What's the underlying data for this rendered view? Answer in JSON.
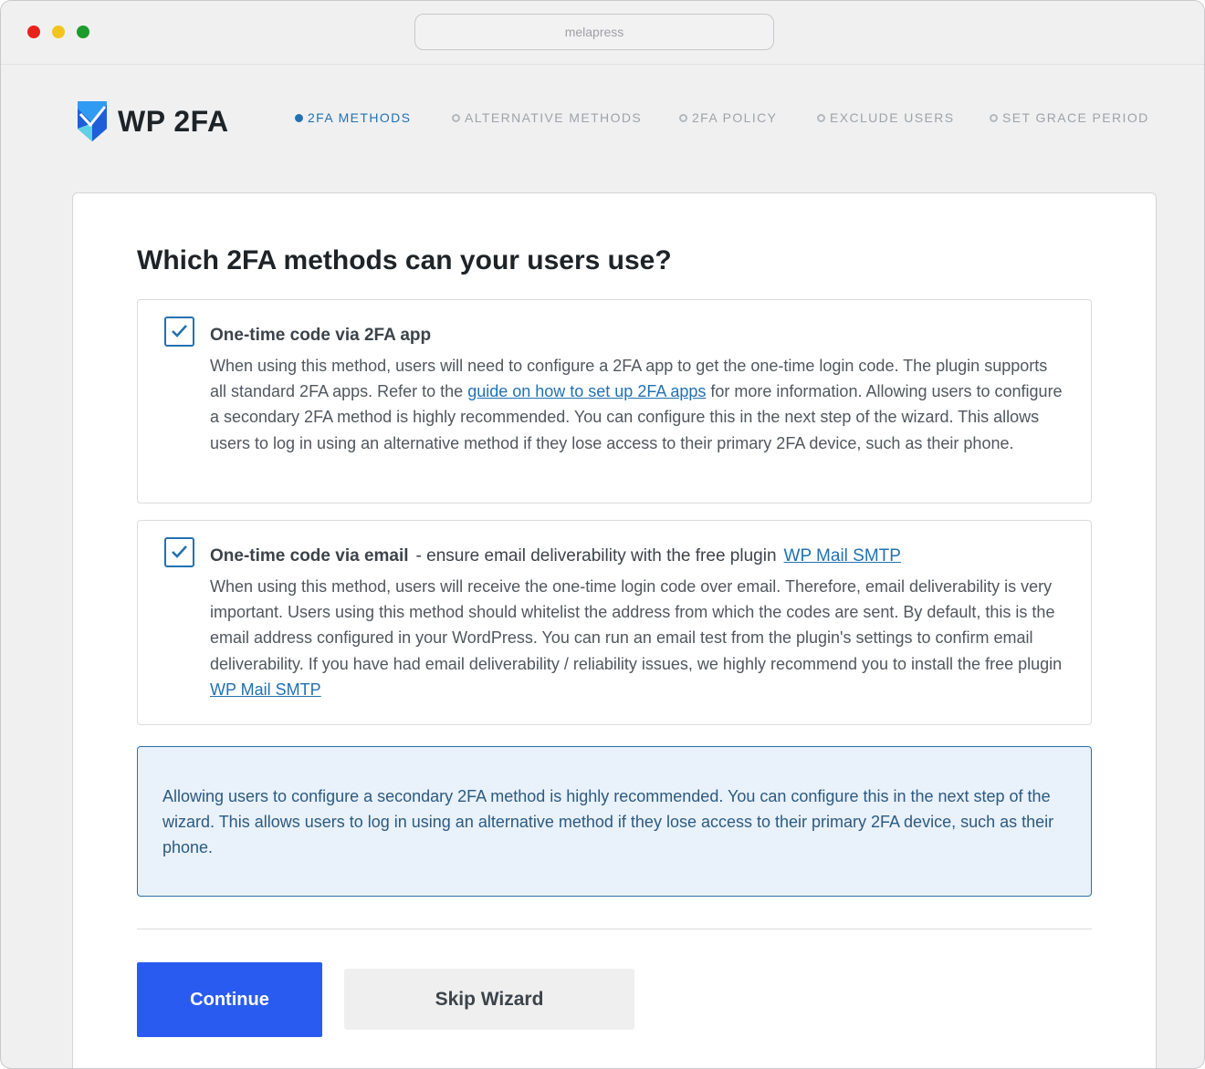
{
  "browser": {
    "url": "melapress"
  },
  "brand": {
    "name": "WP 2FA",
    "colors": {
      "light": "#2f9bf2",
      "dark": "#1f5ed8",
      "cyan": "#5fd1e6"
    }
  },
  "steps": [
    {
      "label": "2FA METHODS",
      "active": true
    },
    {
      "label": "ALTERNATIVE METHODS",
      "active": false
    },
    {
      "label": "2FA POLICY",
      "active": false
    },
    {
      "label": "EXCLUDE USERS",
      "active": false
    },
    {
      "label": "SET GRACE PERIOD",
      "active": false
    }
  ],
  "main": {
    "title": "Which 2FA methods can your users use?",
    "options": [
      {
        "title": "One-time code via 2FA app",
        "checked": true,
        "desc_before_link": "When using this method, users will need to configure a 2FA app to get the one-time login code. The plugin supports all standard 2FA apps. Refer to the ",
        "link": "guide on how to set up 2FA apps",
        "desc_after_link": " for more information. Allowing users to configure a secondary 2FA method is highly recommended. You can configure this in the next step of the wizard. This allows users to log in using an alternative method if they lose access to their primary 2FA device, such as their phone."
      },
      {
        "title": "One-time code via email",
        "checked": true,
        "title_extra": "- ensure email deliverability with the free plugin",
        "title_link": "WP Mail SMTP",
        "desc_before_link": "When using this method, users will receive the one-time login code over email. Therefore, email deliverability is very important. Users using this method should whitelist the address from which the codes are sent. By default, this is the email address configured in your WordPress. You can run an email test from the plugin's settings to confirm email deliverability. If you have had email deliverability / reliability issues, we highly recommend you to install the free plugin ",
        "link": "WP Mail SMTP",
        "desc_after_link": ""
      }
    ],
    "notice": "Allowing users to configure a secondary 2FA method is highly recommended. You can configure this in the next step of the wizard. This allows users to log in using an alternative method if they lose access to their primary 2FA device, such as their phone.",
    "buttons": {
      "continue": "Continue",
      "skip": "Skip Wizard"
    }
  }
}
